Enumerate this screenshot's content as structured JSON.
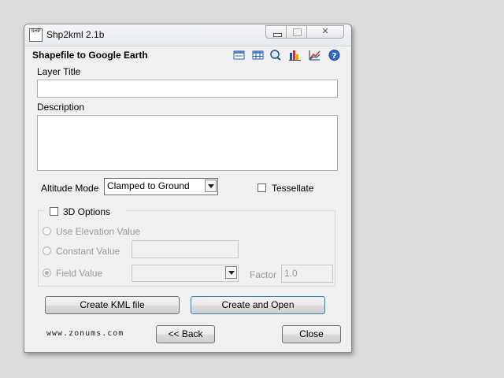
{
  "window": {
    "title": "Shp2kml 2.1b",
    "app_icon_text": "SHP"
  },
  "header": {
    "title": "Shapefile to Google Earth",
    "icons": [
      "table-icon",
      "grid-icon",
      "zoom-icon",
      "chart-bar-icon",
      "chart-line-icon",
      "help-icon"
    ]
  },
  "form": {
    "layer_title_label": "Layer Title",
    "layer_title_value": "",
    "description_label": "Description",
    "description_value": "",
    "altitude_mode_label": "Altitude Mode",
    "altitude_mode_value": "Clamped to Ground",
    "tessellate_label": "Tessellate",
    "tessellate_checked": false
  },
  "options_3d": {
    "label": "3D Options",
    "checked": false,
    "use_elevation_label": "Use Elevation Value",
    "constant_value_label": "Constant Value",
    "constant_value": "",
    "field_value_label": "Field Value",
    "field_value": "",
    "factor_label": "Factor",
    "factor_value": "1.0"
  },
  "buttons": {
    "create_kml": "Create KML file",
    "create_open": "Create and Open",
    "back": "<< Back",
    "close": "Close"
  },
  "footer": {
    "site": "www.zonums.com"
  },
  "colors": {
    "background": "#dcdcdc",
    "window": "#f0f0f0",
    "disabled_text": "#9a9a9a"
  }
}
